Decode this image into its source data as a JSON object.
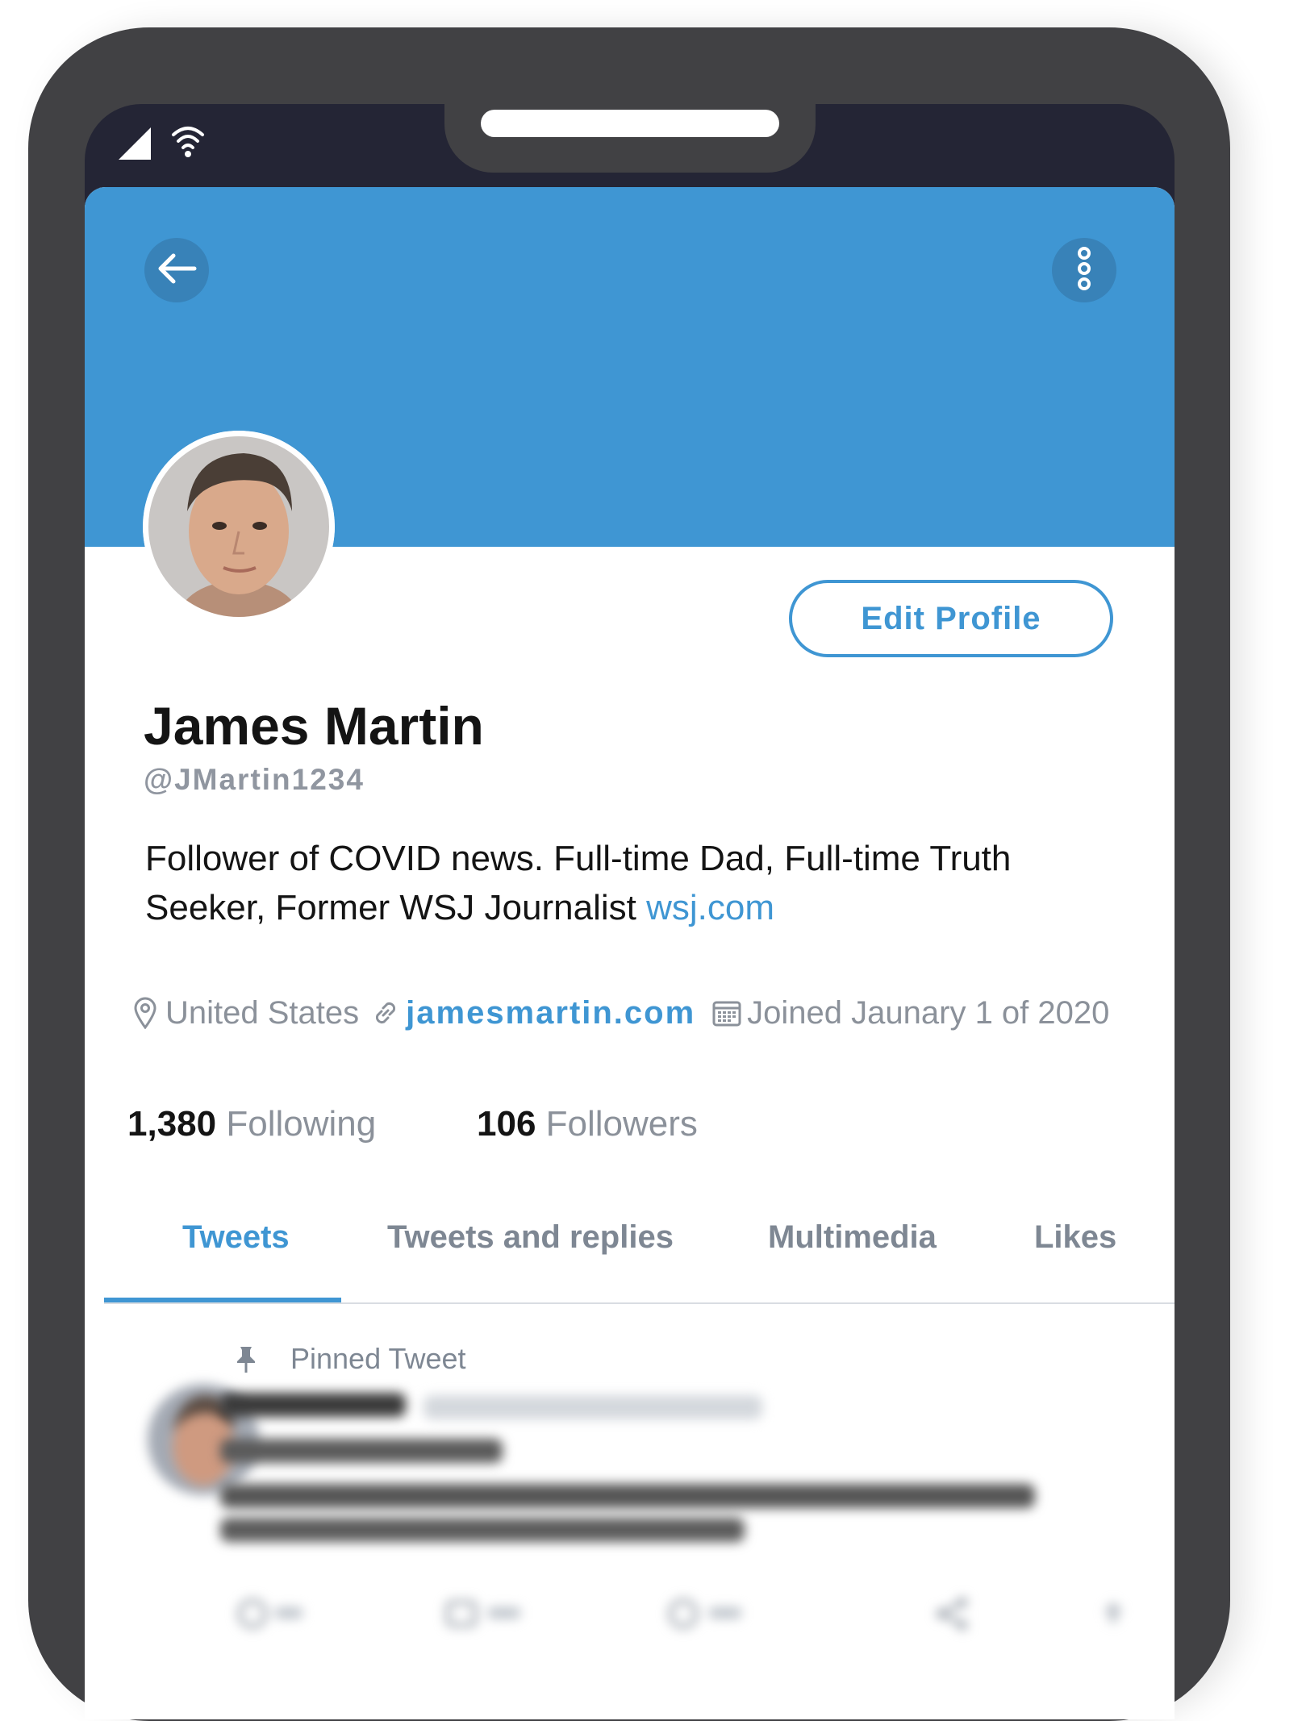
{
  "status_bar": {
    "icons": [
      "cellular-signal-icon",
      "wifi-icon"
    ]
  },
  "header": {
    "back_icon": "arrow-left-icon",
    "more_icon": "vertical-dots-icon"
  },
  "profile": {
    "edit_button": "Edit Profile",
    "name": "James Martin",
    "handle": "@JMartin1234",
    "bio_text": "Follower of COVID news. Full-time Dad, Full-time Truth Seeker, Former WSJ Journalist ",
    "bio_link": "wsj.com",
    "location": "United States",
    "website": "jamesmartin.com",
    "joined": "Joined Jaunary 1 of 2020",
    "following_count": "1,380",
    "following_label": "Following",
    "followers_count": "106",
    "followers_label": "Followers"
  },
  "tabs": [
    {
      "label": "Tweets",
      "active": true
    },
    {
      "label": "Tweets and replies",
      "active": false
    },
    {
      "label": "Multimedia",
      "active": false
    },
    {
      "label": "Likes",
      "active": false
    }
  ],
  "pinned_tweet": {
    "label": "Pinned Tweet",
    "pin_icon": "pin-icon",
    "action_icons": [
      "reply-icon",
      "retweet-icon",
      "like-icon",
      "share-icon",
      "upload-icon"
    ]
  },
  "colors": {
    "accent": "#3f96d3",
    "banner": "#3f96d3",
    "phone_frame": "#414144",
    "text_primary": "#141414",
    "text_secondary": "#8b919a"
  }
}
